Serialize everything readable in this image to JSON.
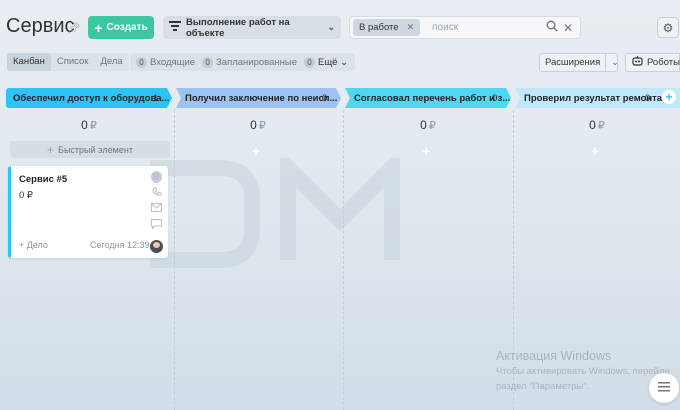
{
  "header": {
    "title": "Сервис",
    "create_label": "Создать",
    "pipeline_label": "Выполнение работ на объекте",
    "filter_chip": "В работе",
    "search_placeholder": "поиск"
  },
  "toolbar": {
    "views": [
      "Канбан",
      "Список",
      "Дела"
    ],
    "active_view": "Канбан",
    "counters": [
      {
        "count": "0",
        "label": "Входящие"
      },
      {
        "count": "0",
        "label": "Запланированные"
      },
      {
        "count": "0",
        "label": "Ещё"
      }
    ],
    "extensions_label": "Расширения",
    "robots_label": "Роботы"
  },
  "stages": [
    {
      "name": "Обеспечил доступ к оборудова...",
      "count": "1",
      "sum": "0",
      "currency": "₽",
      "color": "#2ec3f5"
    },
    {
      "name": "Получил заключение по неисп...",
      "count": "0",
      "sum": "0",
      "currency": "₽",
      "color": "#9dc1f0"
    },
    {
      "name": "Согласовал перечень работ и з...",
      "count": "0",
      "sum": "0",
      "currency": "₽",
      "color": "#4fd7ef"
    },
    {
      "name": "Проверил результат ремонта",
      "count": "0",
      "sum": "0",
      "currency": "₽",
      "color": "#bfe9fa"
    }
  ],
  "quick_add_label": "Быстрый элемент",
  "card": {
    "title": "Сервис #5",
    "sum": "0 ₽",
    "counter": "0",
    "deal_label": "+ Дело",
    "time": "Сегодня 12:39"
  },
  "activation": {
    "heading": "Активация Windows",
    "line1": "Чтобы активировать Windows, перейди",
    "line2": "раздел \"Параметры\"."
  }
}
